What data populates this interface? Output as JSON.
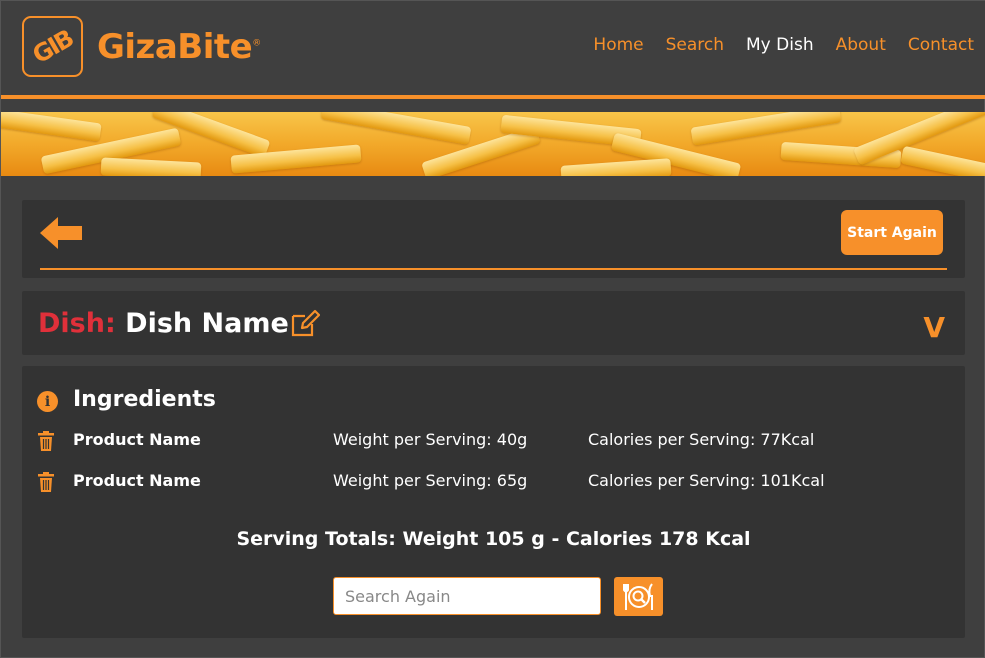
{
  "brand": {
    "logo_text": "GIB",
    "name": "GizaBite",
    "registered": "®"
  },
  "nav": {
    "items": [
      "Home",
      "Search",
      "My Dish",
      "About",
      "Contact"
    ],
    "active": "My Dish"
  },
  "toolbar": {
    "back_icon": "left-arrow-icon",
    "start_again_label": "Start Again"
  },
  "dish": {
    "label": "Dish:",
    "name": "Dish Name",
    "edit_icon": "edit-icon",
    "toggle_glyph": "V"
  },
  "ingredients": {
    "title": "Ingredients",
    "info_glyph": "i",
    "rows": [
      {
        "name": "Product Name",
        "weight": "Weight per Serving: 40g",
        "calories": "Calories per Serving: 77Kcal"
      },
      {
        "name": "Product Name",
        "weight": "Weight per Serving: 65g",
        "calories": "Calories per Serving: 101Kcal"
      }
    ],
    "totals": "Serving Totals: Weight 105 g - Calories 178 Kcal"
  },
  "search": {
    "placeholder": "Search Again",
    "button_icon": "plate-search-icon"
  },
  "colors": {
    "accent": "#f7902a",
    "dish_label": "#e0303a",
    "background": "#3f3f3f",
    "panel": "#333333"
  }
}
